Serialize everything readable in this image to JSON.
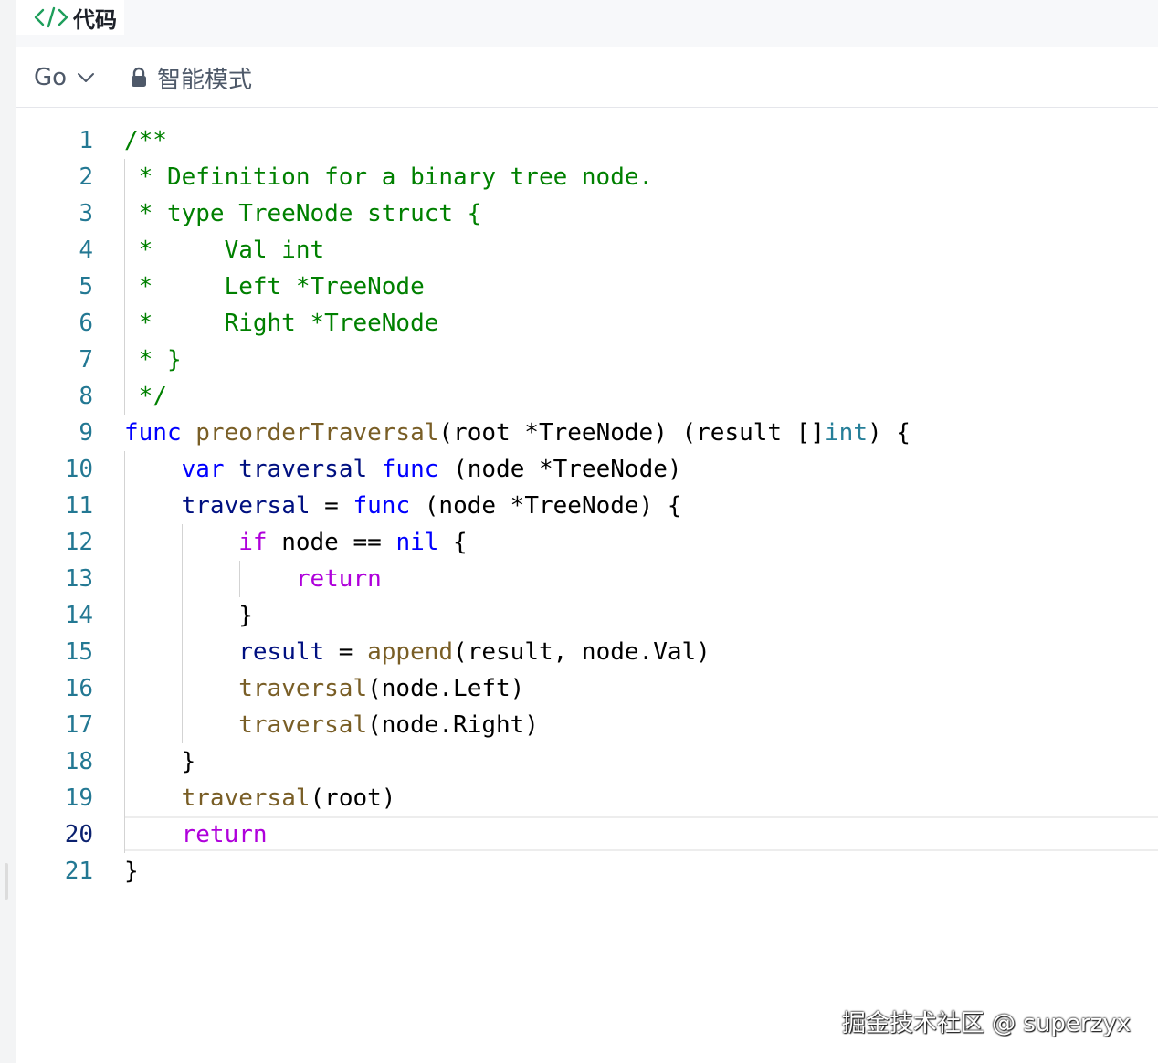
{
  "header": {
    "title": "代码",
    "icon": "code-brackets-icon",
    "icon_color": "#1e9e5b"
  },
  "toolbar": {
    "language": "Go",
    "language_icon": "chevron-down-icon",
    "mode_icon": "lock-icon",
    "mode_label": "智能模式"
  },
  "editor": {
    "current_line": 20,
    "lines": [
      {
        "n": "1",
        "tokens": [
          {
            "t": "/**",
            "c": "comment"
          }
        ]
      },
      {
        "n": "2",
        "tokens": [
          {
            "t": " * Definition for a binary tree node.",
            "c": "comment"
          }
        ]
      },
      {
        "n": "3",
        "tokens": [
          {
            "t": " * type TreeNode struct {",
            "c": "comment"
          }
        ]
      },
      {
        "n": "4",
        "tokens": [
          {
            "t": " *     Val int",
            "c": "comment"
          }
        ]
      },
      {
        "n": "5",
        "tokens": [
          {
            "t": " *     Left *TreeNode",
            "c": "comment"
          }
        ]
      },
      {
        "n": "6",
        "tokens": [
          {
            "t": " *     Right *TreeNode",
            "c": "comment"
          }
        ]
      },
      {
        "n": "7",
        "tokens": [
          {
            "t": " * }",
            "c": "comment"
          }
        ]
      },
      {
        "n": "8",
        "tokens": [
          {
            "t": " */",
            "c": "comment"
          }
        ]
      },
      {
        "n": "9",
        "tokens": [
          {
            "t": "func",
            "c": "kw"
          },
          {
            "t": " ",
            "c": "plain"
          },
          {
            "t": "preorderTraversal",
            "c": "fn"
          },
          {
            "t": "(root *TreeNode) (result []",
            "c": "plain"
          },
          {
            "t": "int",
            "c": "type"
          },
          {
            "t": ") {",
            "c": "plain"
          }
        ]
      },
      {
        "n": "10",
        "tokens": [
          {
            "t": "    ",
            "c": "plain"
          },
          {
            "t": "var",
            "c": "kw"
          },
          {
            "t": " ",
            "c": "plain"
          },
          {
            "t": "traversal",
            "c": "var"
          },
          {
            "t": " ",
            "c": "plain"
          },
          {
            "t": "func",
            "c": "kw"
          },
          {
            "t": " (node *TreeNode)",
            "c": "plain"
          }
        ]
      },
      {
        "n": "11",
        "tokens": [
          {
            "t": "    ",
            "c": "plain"
          },
          {
            "t": "traversal",
            "c": "var"
          },
          {
            "t": " = ",
            "c": "plain"
          },
          {
            "t": "func",
            "c": "kw"
          },
          {
            "t": " (node *TreeNode) {",
            "c": "plain"
          }
        ]
      },
      {
        "n": "12",
        "tokens": [
          {
            "t": "        ",
            "c": "plain"
          },
          {
            "t": "if",
            "c": "ctrl"
          },
          {
            "t": " node == ",
            "c": "plain"
          },
          {
            "t": "nil",
            "c": "kw"
          },
          {
            "t": " {",
            "c": "plain"
          }
        ]
      },
      {
        "n": "13",
        "tokens": [
          {
            "t": "            ",
            "c": "plain"
          },
          {
            "t": "return",
            "c": "ctrl"
          }
        ]
      },
      {
        "n": "14",
        "tokens": [
          {
            "t": "        }",
            "c": "plain"
          }
        ]
      },
      {
        "n": "15",
        "tokens": [
          {
            "t": "        ",
            "c": "plain"
          },
          {
            "t": "result",
            "c": "var"
          },
          {
            "t": " = ",
            "c": "plain"
          },
          {
            "t": "append",
            "c": "fn"
          },
          {
            "t": "(result, node.Val)",
            "c": "plain"
          }
        ]
      },
      {
        "n": "16",
        "tokens": [
          {
            "t": "        ",
            "c": "plain"
          },
          {
            "t": "traversal",
            "c": "fn"
          },
          {
            "t": "(node.Left)",
            "c": "plain"
          }
        ]
      },
      {
        "n": "17",
        "tokens": [
          {
            "t": "        ",
            "c": "plain"
          },
          {
            "t": "traversal",
            "c": "fn"
          },
          {
            "t": "(node.Right)",
            "c": "plain"
          }
        ]
      },
      {
        "n": "18",
        "tokens": [
          {
            "t": "    }",
            "c": "plain"
          }
        ]
      },
      {
        "n": "19",
        "tokens": [
          {
            "t": "    ",
            "c": "plain"
          },
          {
            "t": "traversal",
            "c": "fn"
          },
          {
            "t": "(root)",
            "c": "plain"
          }
        ]
      },
      {
        "n": "20",
        "tokens": [
          {
            "t": "    ",
            "c": "plain"
          },
          {
            "t": "return",
            "c": "ctrl"
          }
        ]
      },
      {
        "n": "21",
        "tokens": [
          {
            "t": "}",
            "c": "plain"
          }
        ]
      }
    ]
  },
  "watermark": "掘金技术社区 @ superzyx"
}
